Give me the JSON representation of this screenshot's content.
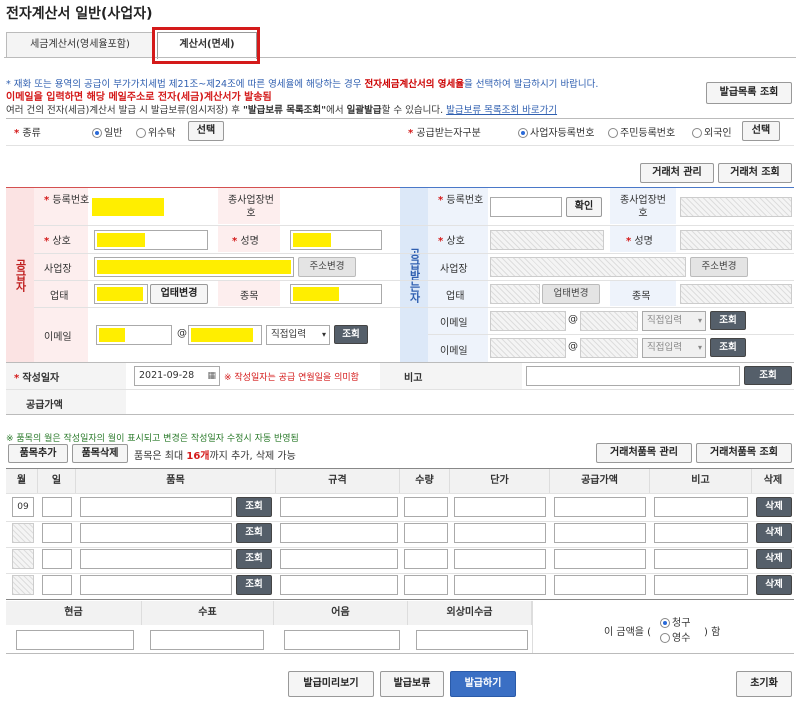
{
  "page": {
    "title": "전자계산서 일반(사업자)"
  },
  "tabs": [
    {
      "label": "세금계산서(영세율포함)"
    },
    {
      "label": "계산서(면세)"
    }
  ],
  "notices": {
    "line1_a": "* 재화 또는 용역의 공급이 부가가치세법 제21조~제24조에 따른 영세율에 해당하는 경우 ",
    "line1_b": "전자세금계산서의 영세율",
    "line1_c": "을 선택하여 발급하시기 바랍니다.",
    "line2": "이메일을 입력하면 해당 메일주소로 전자(세금)계산서가 발송됨",
    "line3_a": "여러 건의 전자(세금)계산서 발급 시 발급보류(임시저장) 후 ",
    "line3_b": "\"발급보류 목록조회\"",
    "line3_c": "에서 ",
    "line3_d": "일괄발급",
    "line3_e": "할 수 있습니다. ",
    "line3_link": "발급보류 목록조회 바로가기"
  },
  "buttons": {
    "issue_list": "발급목록 조회",
    "select": "선택",
    "partner_manage": "거래처 관리",
    "partner_lookup": "거래처 조회",
    "confirm": "확인",
    "change_address": "주소변경",
    "change_business": "업태변경",
    "lookup": "조회",
    "item_manage": "거래처품목 관리",
    "item_lookup": "거래처품목 조회",
    "add_item": "품목추가",
    "delete_item": "품목삭제",
    "delete": "삭제",
    "preview": "발급미리보기",
    "hold": "발급보류",
    "issue": "발급하기",
    "reset": "초기화"
  },
  "type_row": {
    "label": "종류",
    "options": [
      "일반",
      "위수탁"
    ],
    "receiver_label": "공급받는자구분",
    "receiver_options": [
      "사업자등록번호",
      "주민등록번호",
      "외국인"
    ]
  },
  "supplier": {
    "side_label": "공급자",
    "reg_no": "등록번호",
    "branch_no": "종사업장번호",
    "name": "상호",
    "ceo": "성명",
    "address": "사업장",
    "business": "업태",
    "item": "종목",
    "email": "이메일",
    "at": "@",
    "email_select": "직접입력"
  },
  "receiver": {
    "side_label": "공급받는자"
  },
  "date_row": {
    "label": "작성일자",
    "value": "2021-09-28",
    "hint": "※ 작성일자는 공급 연월일을 의미함",
    "remark": "비고"
  },
  "supply_amount_label": "공급가액",
  "items_note": "※ 품목의 월은 작성일자의 월이 표시되고 변경은 작성일자 수정시 자동 반영됨",
  "items_limit_a": "품목은 최대 ",
  "items_limit_b": "16개",
  "items_limit_c": "까지 추가, 삭제 가능",
  "table": {
    "headers": [
      "월",
      "일",
      "품목",
      "규격",
      "수량",
      "단가",
      "공급가액",
      "비고",
      "삭제"
    ],
    "first_month": "09"
  },
  "payment": {
    "headers": [
      "현금",
      "수표",
      "어음",
      "외상미수금"
    ],
    "amount_text_a": "이 금액을 (",
    "claim": "청구",
    "receipt": "영수",
    "amount_text_b": ") 함"
  },
  "colors": {
    "required": "#d41a1a",
    "accent_blue": "#2f5fb0",
    "highlight": "#ffee00",
    "supplier_bg": "#fdeeee",
    "receiver_bg": "#eef3fb"
  }
}
